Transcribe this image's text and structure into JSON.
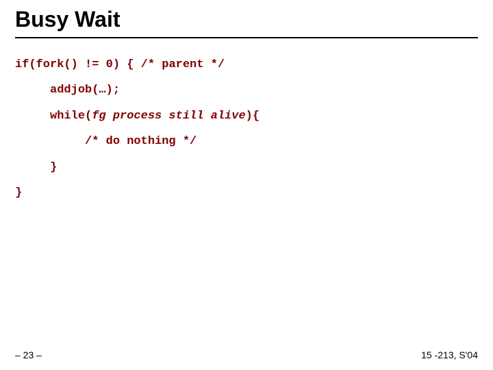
{
  "title": "Busy Wait",
  "code": {
    "l1_pre": "if(fork() != 0) { ",
    "l1_comment": "/* parent */",
    "l2": "     addjob(…);",
    "l3_pre": "     while(",
    "l3_italic": "fg process still alive",
    "l3_post": "){",
    "l4": "          /* do nothing */",
    "l5": "     }",
    "l6": "}"
  },
  "footer": {
    "left": "– 23 –",
    "right": "15 -213, S'04"
  }
}
